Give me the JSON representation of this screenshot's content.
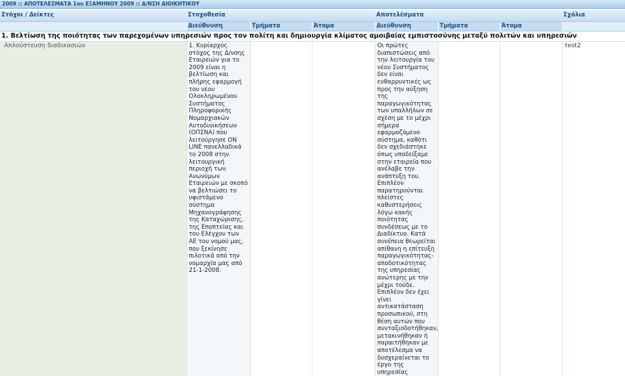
{
  "header": {
    "title": "2009 :: ΑΠΟΤΕΛΕΣΜΑΤΑ 1ου ΕΞΑΜΗΝΟΥ 2009 :: Δ/ΝΣΗ ΔΙΟΙΚΗΤΙΚΟΥ"
  },
  "table": {
    "columns": {
      "goals_indicators": "Στόχοι / Δείκτες",
      "targeting": "Στοχοθεσία",
      "results": "Αποτελέσματα",
      "comments": "Σχόλια"
    },
    "subcolumns": {
      "targeting": [
        "Διεύθυνση",
        "Τμήματα",
        "Άτομα"
      ],
      "results": [
        "Διεύθυνση",
        "Τμήματα",
        "Άτομα"
      ]
    },
    "section": {
      "title": "1. Βελτίωση της ποιότητας των παρεχομένων υπηρεσιών προς τον πολίτη και δημιουργία κλίματος αμοιβαίας εμπιστοσύνης μεταξύ πολιτών και υπηρεσιών"
    },
    "row": {
      "goal": "Απλούστευση διαδικασιών",
      "target_directorate": "1. Κυρίαρχος στόχος της Δ/νσης Εταιρειών για το 2009 είναι η βελτίωση και πλήρης εφαρμογή του νέου Ολοκληρωμένου Συστήματος Πληροφορικής Νομαρχιακών Αυτοδιοικήσεων (ΟΠΣΝΑ) που λειτούργησε ON LINE πανελλαδικά το 2008 στην λειτουργική περιοχή των Ανωνύμων Εταιρειών με σκοπό να βελτιώσει το υφιστάμενο σύστημα Μηχανογράφησης της Καταχώρισης, της Εποπτείας και του Ελέγχου των ΑΕ του νομού μας, που ξεκίνησε πιλοτικά από την νομαρχία μας από 21-1-2008.",
      "target_departments": "",
      "target_persons": "",
      "result_directorate": "Οι πρώτες διαπιστώσεις από την λειτουργία του νέου Συστήματος δεν είναι ενθαρρυντικές ως προς την αύξηση της παραγωγικότητας των υπαλλήλων σε σχέση με το μέχρι σήμερα εφαρμοζόμενο σύστημα, καθότι δεν σχεδιάστηκε όπως υποδείξαμε στην εταιρεία που ανέλαβε την ανάπτυξη του. Επιπλέον παρατηρούνται πλείστες καθυστερήσεις λόγω κακής ποιότητας συνδέσεως με το Διαδίκτυο. Κατά συνέπεια θεωρείται απίθανη η επίτευξη παραγωγικότητας-αποδοτικότητας της υπηρεσίας ανώτερης με την μέχρι τούδε. Επιπλέον δεν έχει γίνει αντικατάσταση προσωπικού, στη θέση αυτών που συνταξιοδοτήθηκαν, μετακινήθηκαν ή παραιτήθηκαν με αποτέλεσμα να δυσχεραίνεται το έργο της υπηρεσίας",
      "result_departments": "",
      "result_persons": "",
      "comment": "test2"
    }
  },
  "colors": {
    "header_text": "#1e4e86",
    "header_bg": "#c3dcf0",
    "goal_cell_bg": "#e7efe4"
  }
}
